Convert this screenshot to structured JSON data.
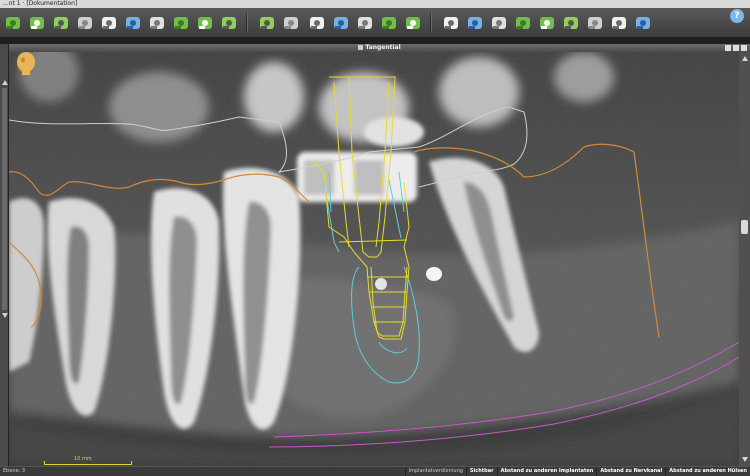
{
  "window": {
    "title": "...nt 1 · [Dokumentation]"
  },
  "toolbar": {
    "groups": [
      {
        "icons": [
          "implant-planning-icon",
          "drill-sleeve-icon",
          "jaw-section-icon",
          "tooth-segment-icon",
          "bone-density-icon",
          "nerve-mark-icon",
          "implant-cylinder-icon",
          "measure-icon",
          "ruler-icon",
          "crown-icon"
        ]
      },
      {
        "icons": [
          "undo-3d-icon",
          "disabled-tool-icon",
          "panorama-icon",
          "move-implant-icon",
          "rotate-implant-icon",
          "cube-view-icon",
          "redo-icon"
        ]
      },
      {
        "icons": [
          "tooth-icon",
          "sleeve-insert-icon",
          "sleeve-remove-icon",
          "abutment-icon",
          "guide-icon",
          "stack-icon",
          "export-icon",
          "filter-icon",
          "filter-toggle-icon"
        ]
      }
    ],
    "help_label": "?"
  },
  "view": {
    "title": "Tangential"
  },
  "scale": {
    "label": "10 mm"
  },
  "status": {
    "left": "Ebene: 3",
    "tools": [
      {
        "label": "Implantatverdünnung",
        "active": false
      },
      {
        "label": "Sichtbar",
        "active": true
      },
      {
        "label": "Abstand zu anderen Implantaten",
        "active": true
      },
      {
        "label": "Abstand zu Nervkanal",
        "active": true
      },
      {
        "label": "Abstand zu anderen Hülsen",
        "active": true
      }
    ]
  },
  "colors": {
    "implant_outline": "#e6dc2a",
    "sleeve_outline": "#5ad0d8",
    "nerve_canal": "#c65ac8",
    "bone_contour": "#d08a3a",
    "soft_tissue": "#cfcfcf"
  }
}
